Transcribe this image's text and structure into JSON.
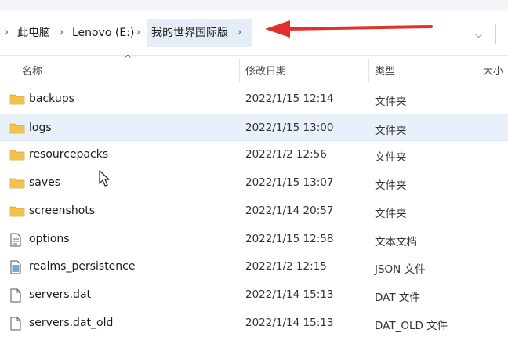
{
  "address_bar": {
    "breadcrumbs": [
      {
        "label": "此电脑"
      },
      {
        "label": "Lenovo (E:)"
      },
      {
        "label": "我的世界国际版"
      }
    ]
  },
  "columns": {
    "name": "名称",
    "date": "修改日期",
    "type": "类型",
    "size": "大小"
  },
  "files": [
    {
      "name": "backups",
      "date": "2022/1/15 12:14",
      "type": "文件夹",
      "icon": "folder-icon"
    },
    {
      "name": "logs",
      "date": "2022/1/15 13:00",
      "type": "文件夹",
      "icon": "folder-icon",
      "selected": true
    },
    {
      "name": "resourcepacks",
      "date": "2022/1/2 12:56",
      "type": "文件夹",
      "icon": "folder-icon"
    },
    {
      "name": "saves",
      "date": "2022/1/15 13:07",
      "type": "文件夹",
      "icon": "folder-icon"
    },
    {
      "name": "screenshots",
      "date": "2022/1/14 20:57",
      "type": "文件夹",
      "icon": "folder-icon"
    },
    {
      "name": "options",
      "date": "2022/1/15 12:58",
      "type": "文本文档",
      "icon": "text-file-icon"
    },
    {
      "name": "realms_persistence",
      "date": "2022/1/2 12:15",
      "type": "JSON 文件",
      "icon": "json-file-icon"
    },
    {
      "name": "servers.dat",
      "date": "2022/1/14 15:13",
      "type": "DAT 文件",
      "icon": "file-icon"
    },
    {
      "name": "servers.dat_old",
      "date": "2022/1/14 15:13",
      "type": "DAT_OLD 文件",
      "icon": "file-icon"
    }
  ],
  "colors": {
    "folder": "#f2c14e",
    "arrow": "#e0312b",
    "selection": "#e8f0fb"
  }
}
